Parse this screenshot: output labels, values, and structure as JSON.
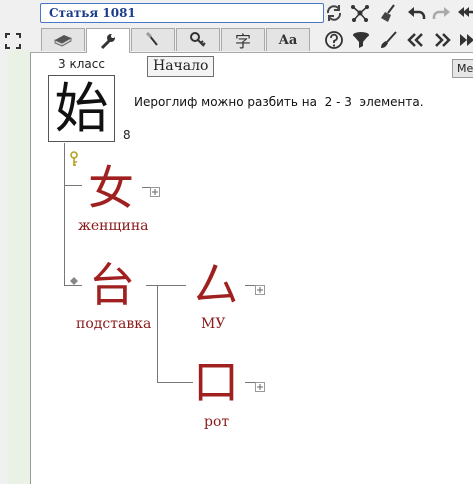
{
  "app": {
    "title": "Статья 1081",
    "tooltip": "Начало",
    "corner_button_label": "Ме"
  },
  "toolbar": {
    "top_icons": [
      "refresh-icon",
      "network-icon",
      "broom-icon",
      "undo-icon",
      "redo-icon",
      "reply-all-icon"
    ],
    "tabs": [
      "book-icon",
      "wrench-icon",
      "brush-icon",
      "key-icon",
      "hanzi-icon",
      "font-icon"
    ],
    "tab_hanzi_label": "字",
    "tab_font_label": "Aa",
    "right_icons": [
      "help-icon",
      "filter-icon",
      "brush-icon",
      "double-left-icon",
      "double-right-icon",
      "fast-forward-icon"
    ]
  },
  "entry": {
    "grade": "3 класс",
    "kanji": "始",
    "stroke_count": "8",
    "decomposition_text": "Иероглиф можно разбить на  2 - 3  элемента."
  },
  "tree": {
    "components": [
      {
        "kanji": "女",
        "meaning": "женщина",
        "marker": "key-icon"
      },
      {
        "kanji": "台",
        "meaning": "подставка",
        "marker": "diamond-icon"
      }
    ],
    "subcomponents": [
      {
        "kanji": "厶",
        "meaning": "МУ"
      },
      {
        "kanji": "口",
        "meaning": "рот"
      }
    ]
  },
  "colors": {
    "component_kanji": "#a02020",
    "component_label": "#8a1a1a",
    "title_text": "#1b3c8a",
    "title_border": "#4a78c8"
  }
}
